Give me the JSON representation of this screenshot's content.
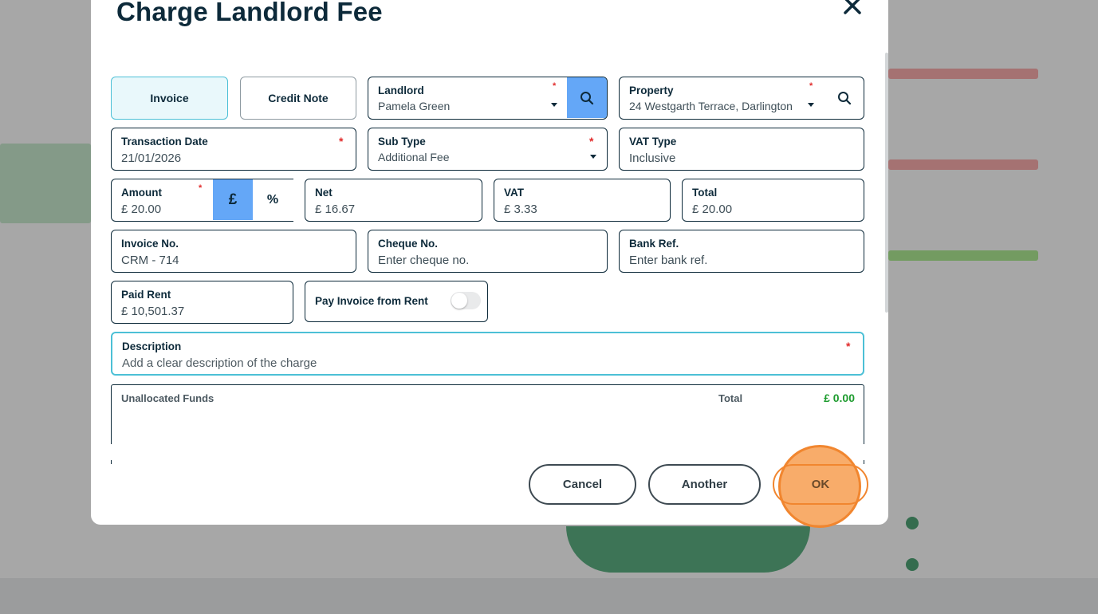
{
  "modal": {
    "title": "Charge Landlord Fee"
  },
  "doc_type": {
    "invoice_label": "Invoice",
    "credit_note_label": "Credit Note",
    "active": "Invoice"
  },
  "landlord": {
    "label": "Landlord",
    "value": "Pamela Green"
  },
  "property": {
    "label": "Property",
    "value": "24 Westgarth Terrace, Darlington"
  },
  "transaction_date": {
    "label": "Transaction Date",
    "value": "21/01/2026"
  },
  "sub_type": {
    "label": "Sub Type",
    "value": "Additional Fee"
  },
  "vat_type": {
    "label": "VAT Type",
    "value": "Inclusive"
  },
  "amount": {
    "label": "Amount",
    "value": "£ 20.00",
    "pound_symbol": "£",
    "percent_symbol": "%"
  },
  "net": {
    "label": "Net",
    "value": "£ 16.67"
  },
  "vat": {
    "label": "VAT",
    "value": "£ 3.33"
  },
  "total": {
    "label": "Total",
    "value": "£ 20.00"
  },
  "invoice_no": {
    "label": "Invoice No.",
    "value": "CRM - 714"
  },
  "cheque_no": {
    "label": "Cheque No.",
    "placeholder": "Enter cheque no."
  },
  "bank_ref": {
    "label": "Bank Ref.",
    "placeholder": "Enter bank ref."
  },
  "paid_rent": {
    "label": "Paid Rent",
    "value": "£ 10,501.37"
  },
  "pay_from_rent": {
    "label": "Pay Invoice from Rent",
    "enabled": false
  },
  "description": {
    "label": "Description",
    "placeholder": "Add a clear description of the charge"
  },
  "unallocated": {
    "label": "Unallocated Funds",
    "total_label": "Total",
    "total_value": "£ 0.00"
  },
  "required_mark": "*",
  "actions": {
    "cancel": "Cancel",
    "another": "Another",
    "ok": "OK"
  },
  "colors": {
    "accent_blue": "#64a7f7",
    "active_tab_bg": "#e9f8fb",
    "active_border": "#4cc0d6",
    "required_red": "#e12b2b",
    "funds_green": "#1e9c2f",
    "ok_highlight": "#f79e50"
  }
}
